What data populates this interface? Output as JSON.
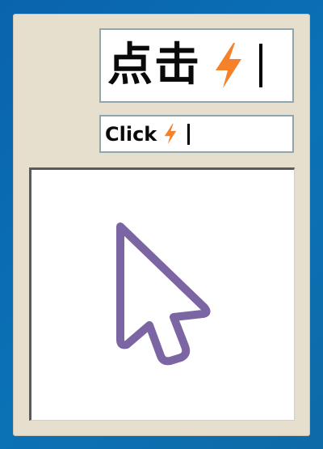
{
  "window": {
    "field_large": {
      "text": "点击",
      "icon": "lightning-bolt-icon"
    },
    "field_small": {
      "text": "Click",
      "icon": "lightning-bolt-icon"
    },
    "canvas": {
      "icon": "mouse-pointer-icon"
    }
  },
  "colors": {
    "desktop": "#0b6db3",
    "panel": "#e6dfcd",
    "field_border": "#8fa6ad",
    "bolt": "#f5822a",
    "cursor_outline": "#7b65a3"
  }
}
